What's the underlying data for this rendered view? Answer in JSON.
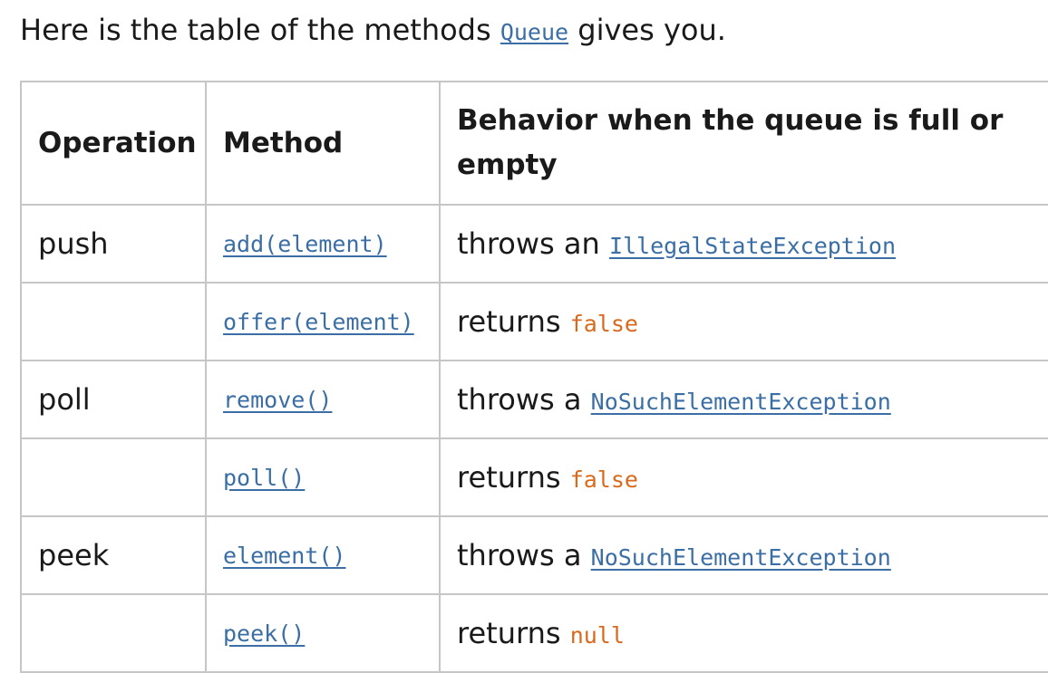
{
  "intro": {
    "before": "Here is the table of the methods ",
    "link": "Queue",
    "after": " gives you."
  },
  "table": {
    "headers": [
      "Operation",
      "Method",
      "Behavior when the queue is full or empty"
    ],
    "rows": [
      {
        "operation": "push",
        "method": "add(element)",
        "behavior_text": "throws an ",
        "behavior_code": "IllegalStateException",
        "behavior_code_kind": "link"
      },
      {
        "operation": "",
        "method": "offer(element)",
        "behavior_text": "returns ",
        "behavior_code": "false",
        "behavior_code_kind": "literal"
      },
      {
        "operation": "poll",
        "method": "remove()",
        "behavior_text": "throws a ",
        "behavior_code": "NoSuchElementException",
        "behavior_code_kind": "link"
      },
      {
        "operation": "",
        "method": "poll()",
        "behavior_text": "returns ",
        "behavior_code": "false",
        "behavior_code_kind": "literal"
      },
      {
        "operation": "peek",
        "method": "element()",
        "behavior_text": "throws a ",
        "behavior_code": "NoSuchElementException",
        "behavior_code_kind": "link"
      },
      {
        "operation": "",
        "method": "peek()",
        "behavior_text": "returns ",
        "behavior_code": "null",
        "behavior_code_kind": "literal"
      }
    ]
  },
  "colors": {
    "link": "#3a6ea5",
    "literal": "#d9691c",
    "border": "#c6c6c6",
    "text": "#1a1a1a"
  }
}
